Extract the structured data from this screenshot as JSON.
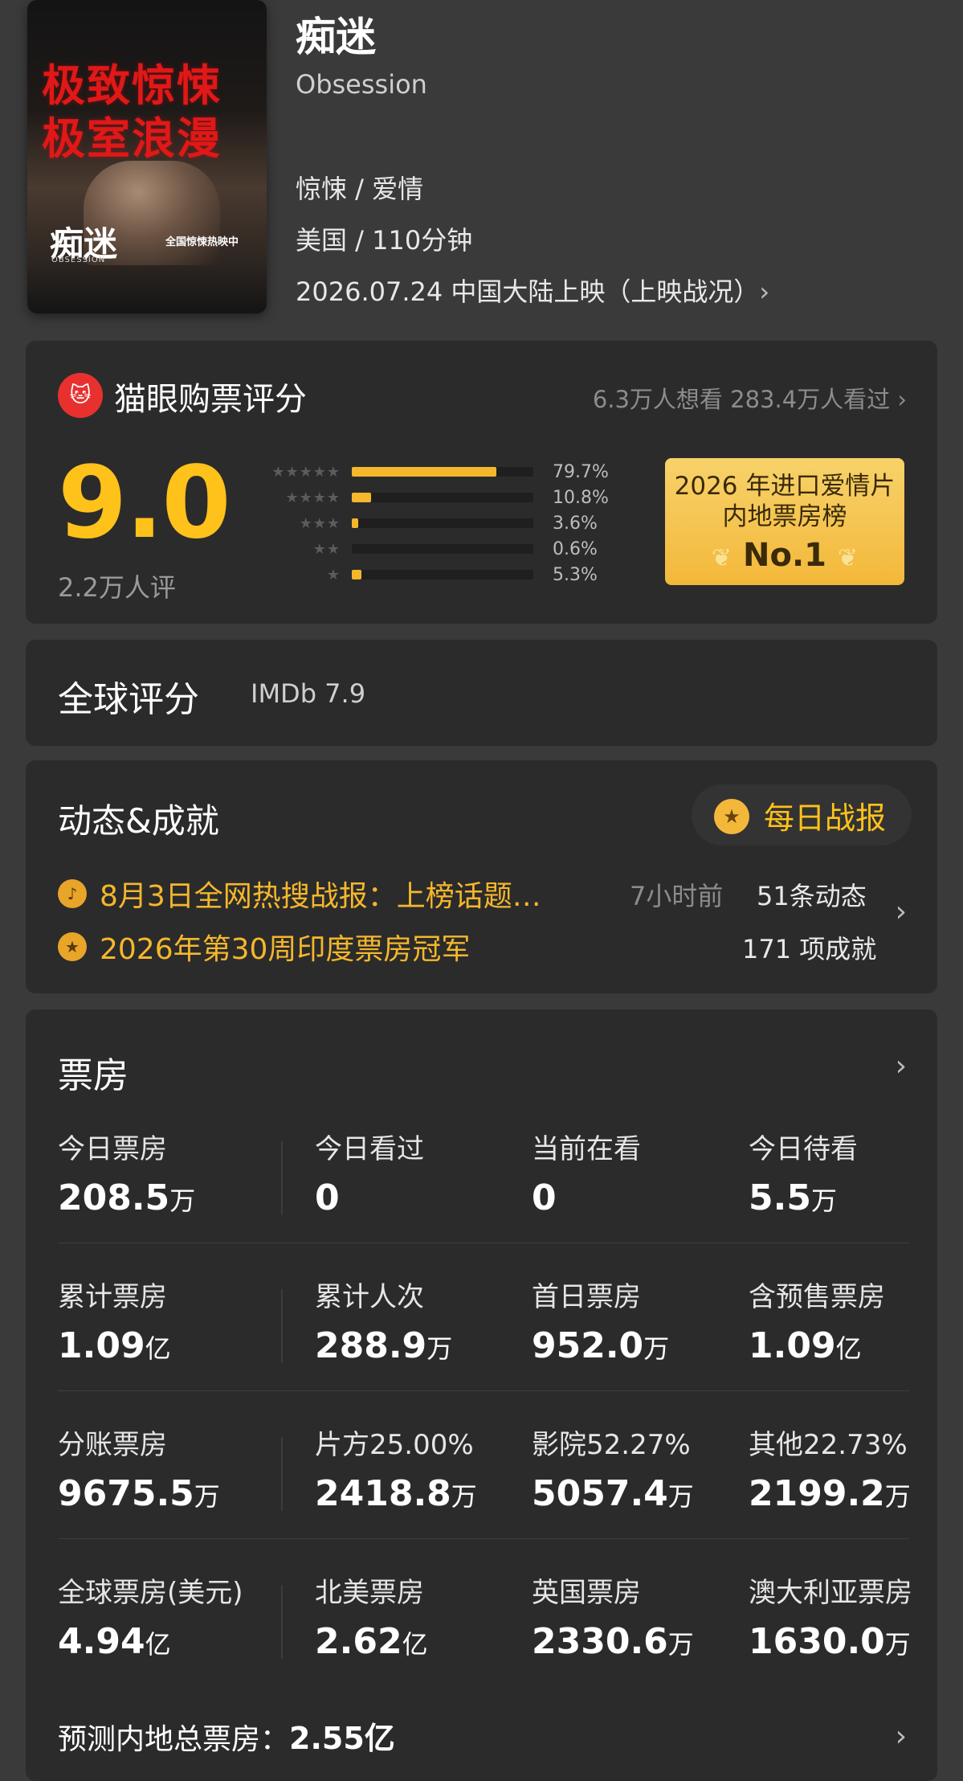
{
  "movie": {
    "poster_tag1": "极致惊悚",
    "poster_tag2": "极室浪漫",
    "poster_title": "痴迷",
    "poster_subtitle": "OBSESSION",
    "poster_hot": "全国惊悚热映中",
    "title": "痴迷",
    "english_title": "Obsession",
    "genre": "惊悚 / 爱情",
    "country_duration": "美国 / 110分钟",
    "release": "2026.07.24 中国大陆上映（上映战况）",
    "release_chevron": "›"
  },
  "maoyan": {
    "logo_icon": "cat-face-icon",
    "logo_glyph": "🐱",
    "title": "猫眼购票评分",
    "want_watched": "6.3万人想看 283.4万人看过",
    "chevron": "›",
    "score": "9.0",
    "score_count": "2.2万人评",
    "distribution": [
      {
        "stars": "★★★★★",
        "percent": 79.7,
        "label": "79.7%"
      },
      {
        "stars": "★★★★",
        "percent": 10.8,
        "label": "10.8%"
      },
      {
        "stars": "★★★",
        "percent": 3.6,
        "label": "3.6%"
      },
      {
        "stars": "★★",
        "percent": 0.6,
        "label": "0.6%"
      },
      {
        "stars": "★",
        "percent": 5.3,
        "label": "5.3%"
      }
    ],
    "award_line1": "2026 年进口爱情片",
    "award_line2": "内地票房榜",
    "award_rank": "No.1"
  },
  "global": {
    "title": "全球评分",
    "imdb": "IMDb 7.9"
  },
  "dynamics": {
    "title": "动态&成就",
    "daily_report": "每日战报",
    "news": "8月3日全网热搜战报：上榜话题…",
    "news_time": "7小时前",
    "news_count": "51条动态",
    "achievement": "2026年第30周印度票房冠军",
    "achievement_count": "171 项成就",
    "chevron": "›"
  },
  "box_office": {
    "title": "票房",
    "chevron": "›",
    "rows": [
      [
        {
          "label": "今日票房",
          "num": "208.5",
          "unit": "万"
        },
        {
          "label": "今日看过",
          "num": "0",
          "unit": ""
        },
        {
          "label": "当前在看",
          "num": "0",
          "unit": ""
        },
        {
          "label": "今日待看",
          "num": "5.5",
          "unit": "万"
        }
      ],
      [
        {
          "label": "累计票房",
          "num": "1.09",
          "unit": "亿"
        },
        {
          "label": "累计人次",
          "num": "288.9",
          "unit": "万"
        },
        {
          "label": "首日票房",
          "num": "952.0",
          "unit": "万"
        },
        {
          "label": "含预售票房",
          "num": "1.09",
          "unit": "亿"
        }
      ],
      [
        {
          "label": "分账票房",
          "num": "9675.5",
          "unit": "万"
        },
        {
          "label": "片方25.00%",
          "num": "2418.8",
          "unit": "万"
        },
        {
          "label": "影院52.27%",
          "num": "5057.4",
          "unit": "万"
        },
        {
          "label": "其他22.73%",
          "num": "2199.2",
          "unit": "万"
        }
      ],
      [
        {
          "label": "全球票房(美元)",
          "num": "4.94",
          "unit": "亿"
        },
        {
          "label": "北美票房",
          "num": "2.62",
          "unit": "亿"
        },
        {
          "label": "英国票房",
          "num": "2330.6",
          "unit": "万"
        },
        {
          "label": "澳大利亚票房",
          "num": "1630.0",
          "unit": "万"
        }
      ]
    ],
    "prediction_label": "预测内地总票房：",
    "prediction_value": "2.55亿"
  },
  "colors": {
    "accent": "#ffc21a",
    "bar": "#f5b72c",
    "card": "#2b2b2b",
    "page": "#3a3a3a"
  }
}
